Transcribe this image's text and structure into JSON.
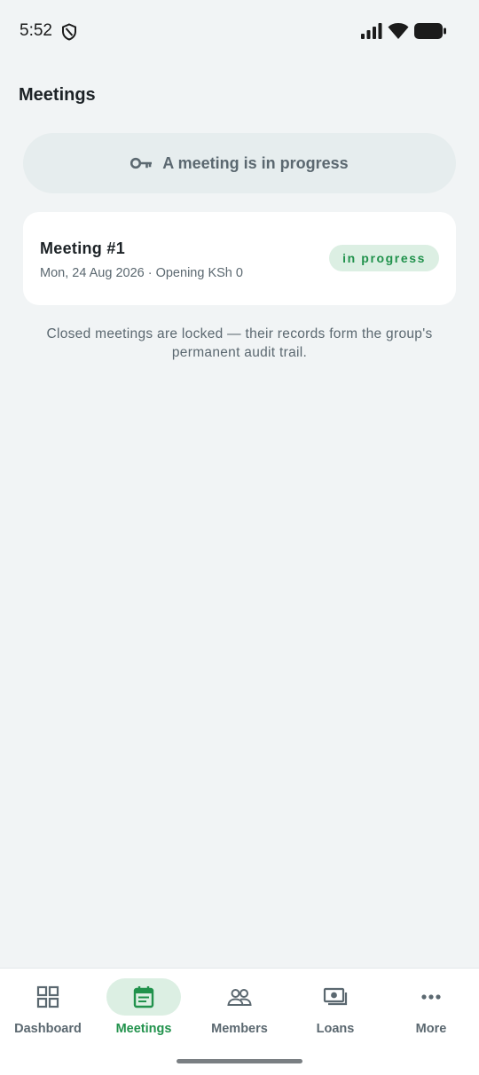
{
  "status_bar": {
    "time": "5:52"
  },
  "header": {
    "title": "Meetings"
  },
  "banner": {
    "icon": "key-icon",
    "text": "A meeting is in progress"
  },
  "meetings": [
    {
      "title": "Meeting #1",
      "subtitle": "Mon, 24 Aug 2026 · Opening KSh 0",
      "status": "in progress"
    }
  ],
  "footnote": "Closed meetings are locked — their records form the group's permanent audit trail.",
  "bottom_nav": {
    "active": "Meetings",
    "items": [
      {
        "label": "Dashboard",
        "icon": "dashboard-grid-icon"
      },
      {
        "label": "Meetings",
        "icon": "calendar-icon"
      },
      {
        "label": "Members",
        "icon": "members-icon"
      },
      {
        "label": "Loans",
        "icon": "cash-icon"
      },
      {
        "label": "More",
        "icon": "more-dots-icon"
      }
    ]
  },
  "colors": {
    "accent": "#21924c",
    "accent_bg": "#dcefe3",
    "page_bg": "#f1f4f5",
    "muted_text": "#5b6870"
  }
}
